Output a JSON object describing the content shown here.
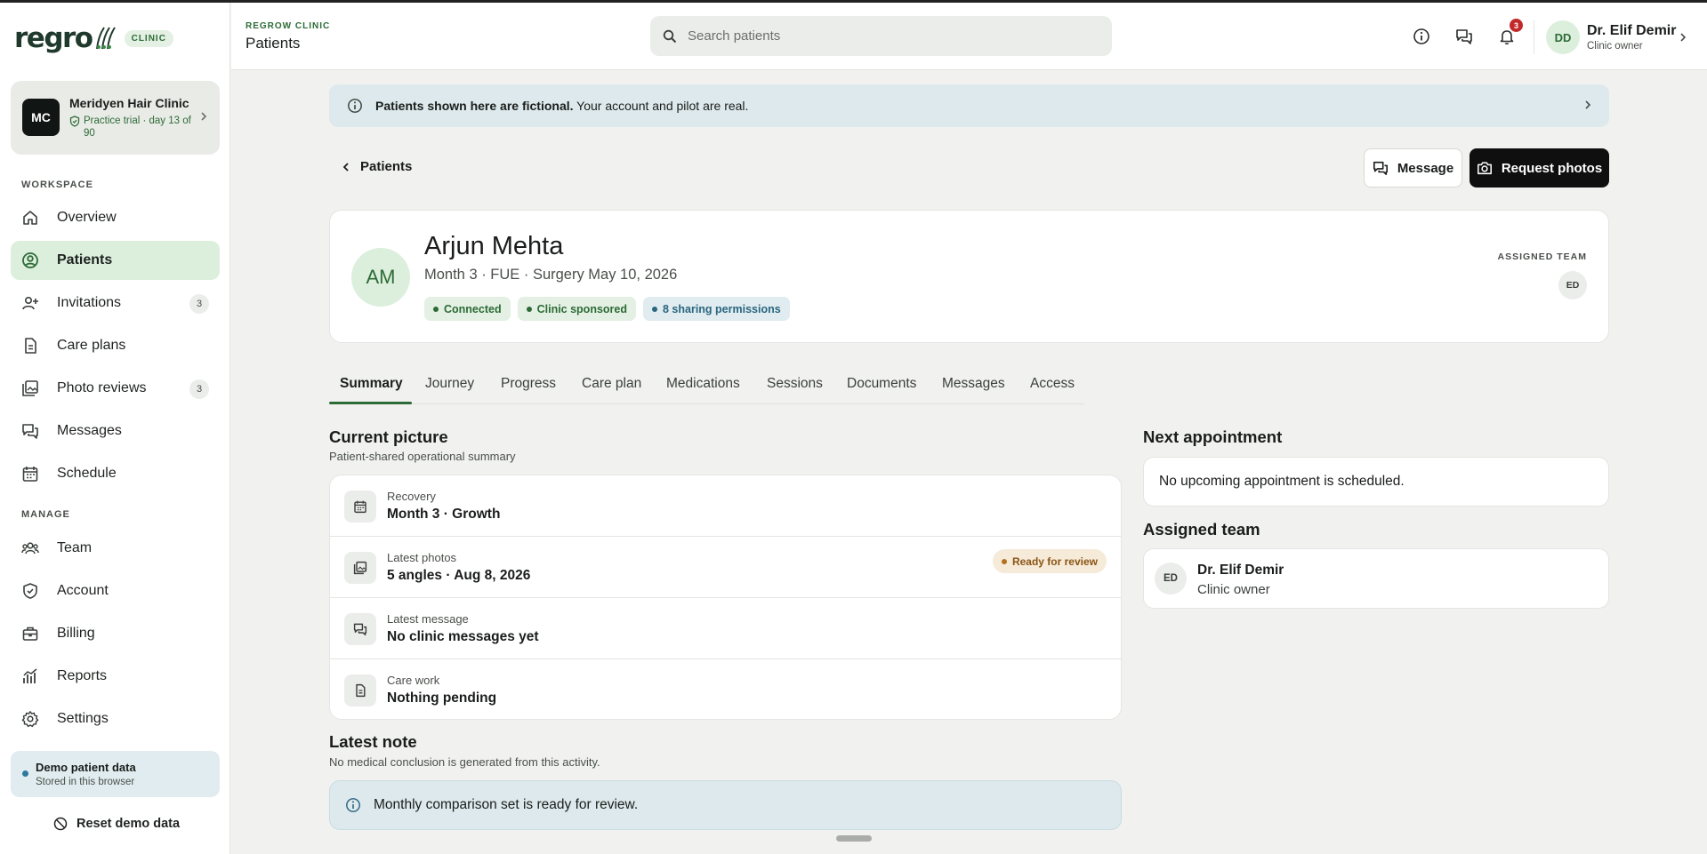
{
  "brand": {
    "logo_text": "regro",
    "badge": "CLINIC"
  },
  "org": {
    "initials": "MC",
    "name": "Meridyen Hair Clinic",
    "trial": "Practice trial · day 13 of 90"
  },
  "sidebar": {
    "workspace_label": "WORKSPACE",
    "manage_label": "MANAGE",
    "workspace_items": [
      {
        "label": "Overview",
        "icon": "home-icon"
      },
      {
        "label": "Patients",
        "icon": "patients-icon",
        "active": true
      },
      {
        "label": "Invitations",
        "icon": "user-plus-icon",
        "badge": "3"
      },
      {
        "label": "Care plans",
        "icon": "document-icon"
      },
      {
        "label": "Photo reviews",
        "icon": "photos-icon",
        "badge": "3"
      },
      {
        "label": "Messages",
        "icon": "chat-icon"
      },
      {
        "label": "Schedule",
        "icon": "calendar-icon"
      }
    ],
    "manage_items": [
      {
        "label": "Team",
        "icon": "team-icon"
      },
      {
        "label": "Account",
        "icon": "shield-icon"
      },
      {
        "label": "Billing",
        "icon": "billing-icon"
      },
      {
        "label": "Reports",
        "icon": "chart-icon"
      },
      {
        "label": "Settings",
        "icon": "gear-icon"
      }
    ],
    "demo": {
      "title": "Demo patient data",
      "subtitle": "Stored in this browser"
    },
    "reset_label": "Reset demo data"
  },
  "header": {
    "eyebrow": "REGROW CLINIC",
    "title": "Patients",
    "search_placeholder": "Search patients",
    "notification_count": "3",
    "user": {
      "initials": "DD",
      "name": "Dr. Elif Demir",
      "role": "Clinic owner"
    }
  },
  "banner": {
    "bold": "Patients shown here are fictional.",
    "text": " Your account and pilot are real."
  },
  "nav": {
    "back_label": "Patients",
    "message_button": "Message",
    "request_button": "Request photos"
  },
  "patient": {
    "initials": "AM",
    "name": "Arjun Mehta",
    "meta": "Month 3 · FUE · Surgery May 10, 2026",
    "chips": [
      {
        "label": "Connected",
        "tone": "green"
      },
      {
        "label": "Clinic sponsored",
        "tone": "green"
      },
      {
        "label": "8 sharing permissions",
        "tone": "blue"
      }
    ],
    "assigned_team_label": "ASSIGNED TEAM",
    "assigned_team_initials": "ED"
  },
  "tabs": [
    "Summary",
    "Journey",
    "Progress",
    "Care plan",
    "Medications",
    "Sessions",
    "Documents",
    "Messages",
    "Access"
  ],
  "active_tab": "Summary",
  "current_picture": {
    "title": "Current picture",
    "subtitle": "Patient-shared operational summary",
    "rows": [
      {
        "label": "Recovery",
        "value": "Month 3 · Growth",
        "icon": "calendar-icon"
      },
      {
        "label": "Latest photos",
        "value": "5 angles · Aug 8, 2026",
        "icon": "photos-icon",
        "badge": "Ready for review"
      },
      {
        "label": "Latest message",
        "value": "No clinic messages yet",
        "icon": "chat-icon"
      },
      {
        "label": "Care work",
        "value": "Nothing pending",
        "icon": "document-icon"
      }
    ]
  },
  "latest_note": {
    "title": "Latest note",
    "subtitle": "No medical conclusion is generated from this activity.",
    "text": "Monthly comparison set is ready for review."
  },
  "next_appointment": {
    "title": "Next appointment",
    "text": "No upcoming appointment is scheduled."
  },
  "assigned_team": {
    "title": "Assigned team",
    "members": [
      {
        "initials": "ED",
        "name": "Dr. Elif Demir",
        "role": "Clinic owner"
      }
    ]
  }
}
